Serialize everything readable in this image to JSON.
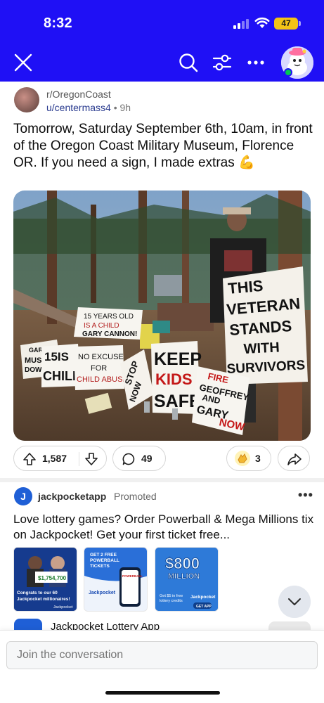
{
  "status_bar": {
    "time": "8:32",
    "battery": "47"
  },
  "nav": {
    "close_icon": "close-icon",
    "search_icon": "search-icon",
    "filter_icon": "filter-icon",
    "more_icon": "more-icon"
  },
  "post": {
    "community": "r/OregonCoast",
    "author": "u/centermass4",
    "separator": "•",
    "age": "9h",
    "title": "Tomorrow, Saturday September 6th, 10am, in front of the Oregon Coast Military Museum, Florence OR. If you need a sign, I made extras 💪",
    "signs": {
      "main": [
        "THIS",
        "VETERAN",
        "STANDS",
        "WITH",
        "SURVIVORS"
      ],
      "gary": [
        "15 YEARS OLD",
        "IS A CHILD",
        "GARY CANNON!"
      ],
      "excuse": [
        "NO EXCUSE",
        "FOR",
        "CHILD ABUSE"
      ],
      "keep": [
        "KEEP",
        "KIDS",
        "SAFE"
      ],
      "fire": [
        "FIRE",
        "GEOFFREY",
        "AND",
        "GARY",
        "NOW"
      ],
      "left": [
        "GARY CA",
        "MUS",
        "DOWN"
      ],
      "is": [
        "15IS",
        "CHILD"
      ],
      "stop": [
        "STOP",
        "NOW"
      ]
    },
    "upvotes": "1,587",
    "comments": "49",
    "awards": "3"
  },
  "ad": {
    "logo_letter": "J",
    "advertiser": "jackpocketapp",
    "promoted": "Promoted",
    "more": "•••",
    "text": "Love lottery games? Order Powerball & Mega Millions tix on Jackpocket! Get your first ticket free...",
    "thumbs": {
      "t1_amount": "$1,754,700",
      "t1_text1": "Congrats to our 60",
      "t1_text2": "Jackpocket millionaires!",
      "t1_brand": "Jackpocket",
      "t2_line1": "GET 2 FREE",
      "t2_line2": "POWERBALL",
      "t2_line3": "TICKETS",
      "t2_phone": "POWERBALL",
      "t2_brand": "Jackpocket",
      "t3_amount": "$800",
      "t3_million": "MILLION",
      "t3_text1": "Get $5 in free",
      "t3_text2": "lottery credits",
      "t3_brand": "Jackpocket",
      "t3_cta": "GET APP"
    },
    "app_name": "Jackpocket Lottery App"
  },
  "composer": {
    "placeholder": "Join the conversation"
  },
  "colors": {
    "header_blue": "#1f10f5",
    "battery_yellow": "#f3c316",
    "link_blue": "#2a3b8f",
    "online_green": "#00c853"
  }
}
